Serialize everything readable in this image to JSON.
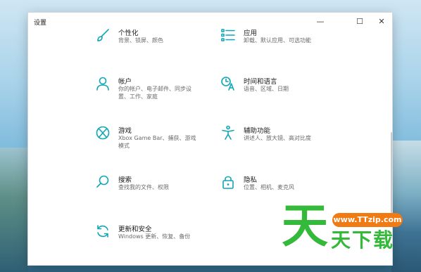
{
  "window": {
    "title": "设置",
    "min_glyph": "—",
    "max_glyph": "☐",
    "close_glyph": "✕"
  },
  "items": [
    {
      "label": "个性化",
      "desc": "背景、锁屏、颜色",
      "icon": "brush-icon"
    },
    {
      "label": "应用",
      "desc": "卸载、默认应用、可选功能",
      "icon": "apps-list-icon"
    },
    {
      "label": "帐户",
      "desc": "你的帐户、电子邮件、同步设置、工作、家庭",
      "icon": "account-person-icon"
    },
    {
      "label": "时间和语言",
      "desc": "语音、区域、日期",
      "icon": "time-language-icon"
    },
    {
      "label": "游戏",
      "desc": "Xbox Game Bar、捕获、游戏模式",
      "icon": "xbox-icon"
    },
    {
      "label": "辅助功能",
      "desc": "讲述人、放大镜、高对比度",
      "icon": "accessibility-icon"
    },
    {
      "label": "搜索",
      "desc": "查找我的文件、权限",
      "icon": "search-icon"
    },
    {
      "label": "隐私",
      "desc": "位置、相机、麦克风",
      "icon": "lock-icon"
    },
    {
      "label": "更新和安全",
      "desc": "Windows 更新、恢复、备份",
      "icon": "update-sync-icon"
    }
  ],
  "watermark": {
    "big_char": "天",
    "url": "www.TTzip.com",
    "sub_text": "天下载"
  },
  "colors": {
    "icon_accent": "#0fa6b5",
    "watermark_green": "#35b93a",
    "watermark_orange": "#f07a14"
  }
}
